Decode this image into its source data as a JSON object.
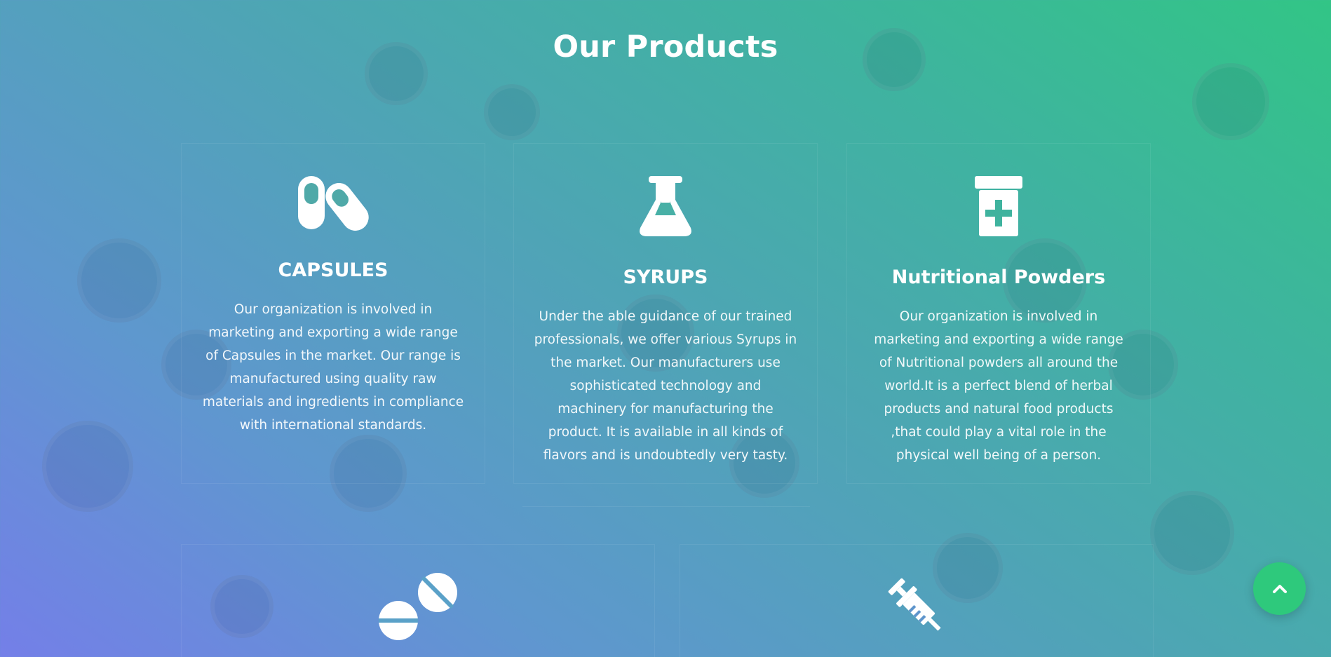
{
  "section": {
    "title": "Our Products"
  },
  "products": [
    {
      "name": "CAPSULES",
      "icon": "capsules-icon",
      "description": "Our organization is involved in marketing and exporting a wide range of Capsules in the market. Our range is manufactured using quality raw materials and ingredients in compliance with international standards."
    },
    {
      "name": "SYRUPS",
      "icon": "flask-icon",
      "description": "Under the able guidance of our trained professionals, we offer various Syrups in the market. Our manufacturers use sophisticated technology and machinery for manufacturing the product. It is available in all kinds of flavors and is undoubtedly very tasty."
    },
    {
      "name": "Nutritional Powders",
      "icon": "prescription-bottle-icon",
      "description": "Our organization is involved in marketing and exporting a wide range of Nutritional powders all around the world.It is a perfect blend of herbal products and natural food products ,that could play a vital role in the physical well being of a person."
    },
    {
      "icon": "tablets-icon"
    },
    {
      "icon": "syringe-icon"
    }
  ],
  "back_to_top": {
    "icon": "chevron-up-icon"
  },
  "colors": {
    "gradient_top_right": "#32c586",
    "gradient_bottom_left": "#747fe8",
    "accent_green": "#2ec97c",
    "text": "#ffffff"
  }
}
